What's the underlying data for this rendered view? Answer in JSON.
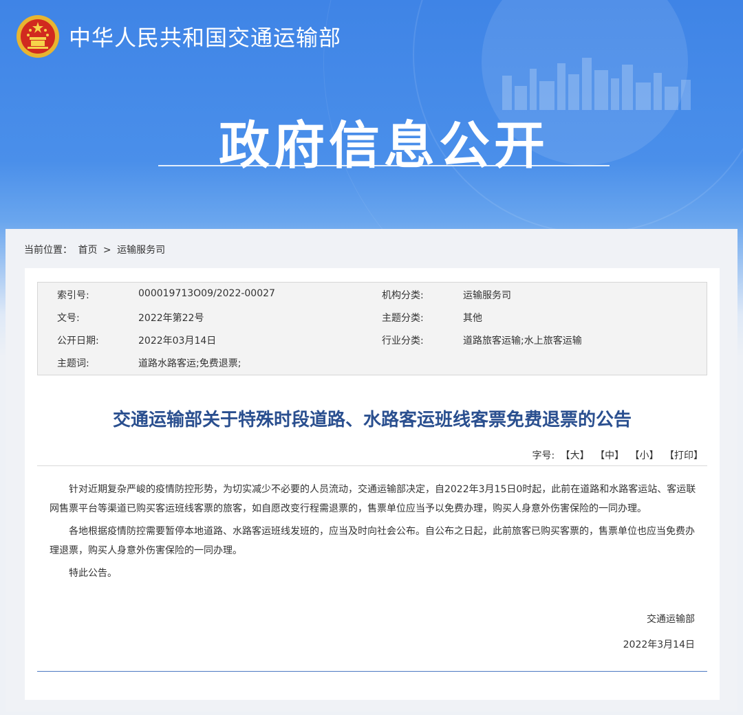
{
  "header": {
    "ministry_name": "中华人民共和国交通运输部",
    "banner_title": "政府信息公开"
  },
  "breadcrumb": {
    "label": "当前位置：",
    "home": "首页",
    "separator": ">",
    "current": "运输服务司"
  },
  "metadata": {
    "rows": [
      {
        "label1": "索引号:",
        "value1": "000019713O09/2022-00027",
        "label2": "机构分类:",
        "value2": "运输服务司"
      },
      {
        "label1": "文号:",
        "value1": "2022年第22号",
        "label2": "主题分类:",
        "value2": "其他"
      },
      {
        "label1": "公开日期:",
        "value1": "2022年03月14日",
        "label2": "行业分类:",
        "value2": "道路旅客运输;水上旅客运输"
      },
      {
        "label1": "主题词:",
        "value1": "道路水路客运;免费退票;",
        "label2": "",
        "value2": ""
      }
    ]
  },
  "article": {
    "title": "交通运输部关于特殊时段道路、水路客运班线客票免费退票的公告",
    "font_size_label": "字号:",
    "font_size_options": [
      "【大】",
      "【中】",
      "【小】",
      "【打印】"
    ],
    "paragraphs": [
      "针对近期复杂严峻的疫情防控形势，为切实减少不必要的人员流动，交通运输部决定，自2022年3月15日0时起，此前在道路和水路客运站、客运联网售票平台等渠道已购买客运班线客票的旅客，如自愿改变行程需退票的，售票单位应当予以免费办理，购买人身意外伤害保险的一同办理。",
      "各地根据疫情防控需要暂停本地道路、水路客运班线发班的，应当及时向社会公布。自公布之日起，此前旅客已购买客票的，售票单位也应当免费办理退票，购买人身意外伤害保险的一同办理。",
      "特此公告。"
    ],
    "signature_org": "交通运输部",
    "signature_date": "2022年3月14日"
  },
  "colors": {
    "banner_blue": "#3f84e6",
    "title_blue": "#2a4f8f",
    "rule_blue": "#4a78c2"
  }
}
